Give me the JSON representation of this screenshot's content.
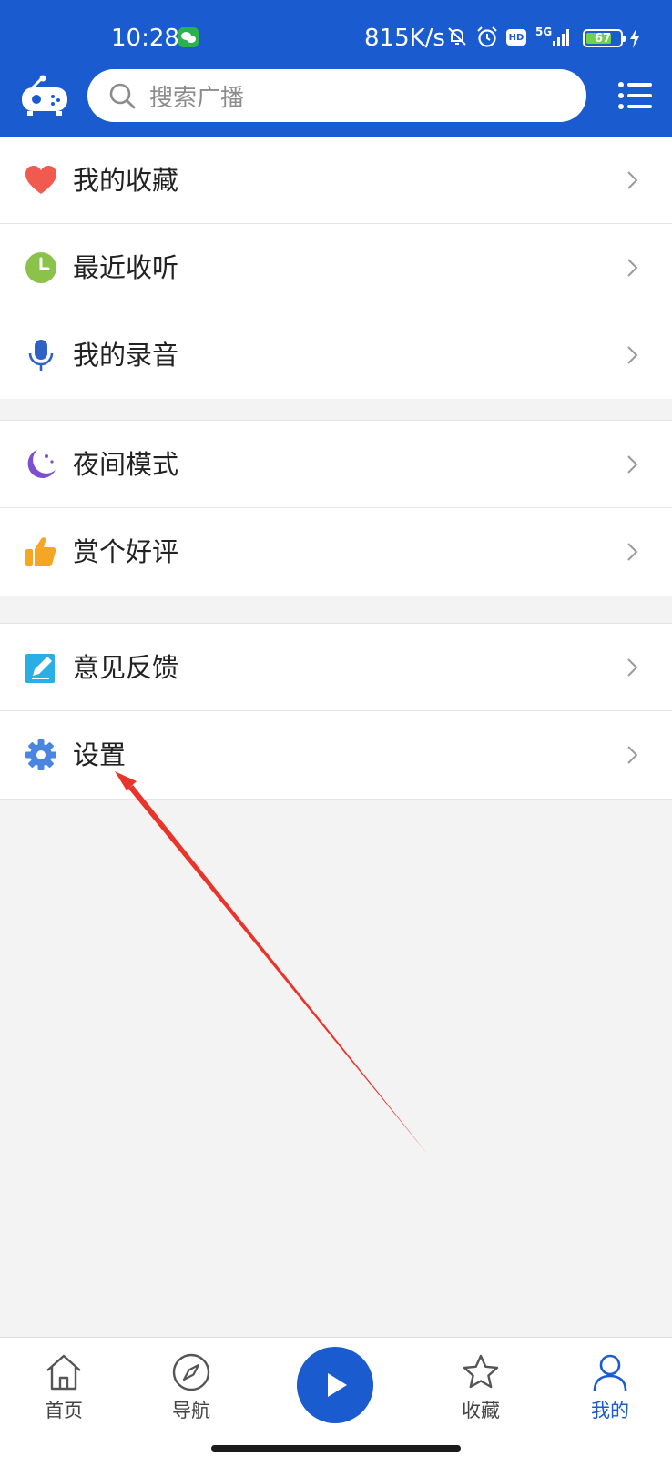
{
  "status_bar": {
    "time": "10:28",
    "network_speed": "815K/s",
    "hd": "HD",
    "signal": "5G",
    "battery": "67"
  },
  "header": {
    "search_placeholder": "搜索广播"
  },
  "menu": {
    "group1": [
      {
        "label": "我的收藏",
        "icon": "heart-icon"
      },
      {
        "label": "最近收听",
        "icon": "clock-icon"
      },
      {
        "label": "我的录音",
        "icon": "microphone-icon"
      }
    ],
    "group2": [
      {
        "label": "夜间模式",
        "icon": "moon-icon"
      },
      {
        "label": "赏个好评",
        "icon": "thumbs-up-icon"
      }
    ],
    "group3": [
      {
        "label": "意见反馈",
        "icon": "edit-icon"
      },
      {
        "label": "设置",
        "icon": "gear-icon"
      }
    ]
  },
  "tabbar": {
    "home": "首页",
    "nav": "导航",
    "fav": "收藏",
    "mine": "我的",
    "active": "mine"
  },
  "colors": {
    "brand": "#1a5ccf",
    "heart": "#f05a4f",
    "clock": "#8bc34a",
    "mic": "#2e62c7",
    "moon": "#7b4fd0",
    "thumb": "#f5a623",
    "edit": "#29aee6",
    "gear": "#4a86e0",
    "annotation": "#e8342a"
  }
}
